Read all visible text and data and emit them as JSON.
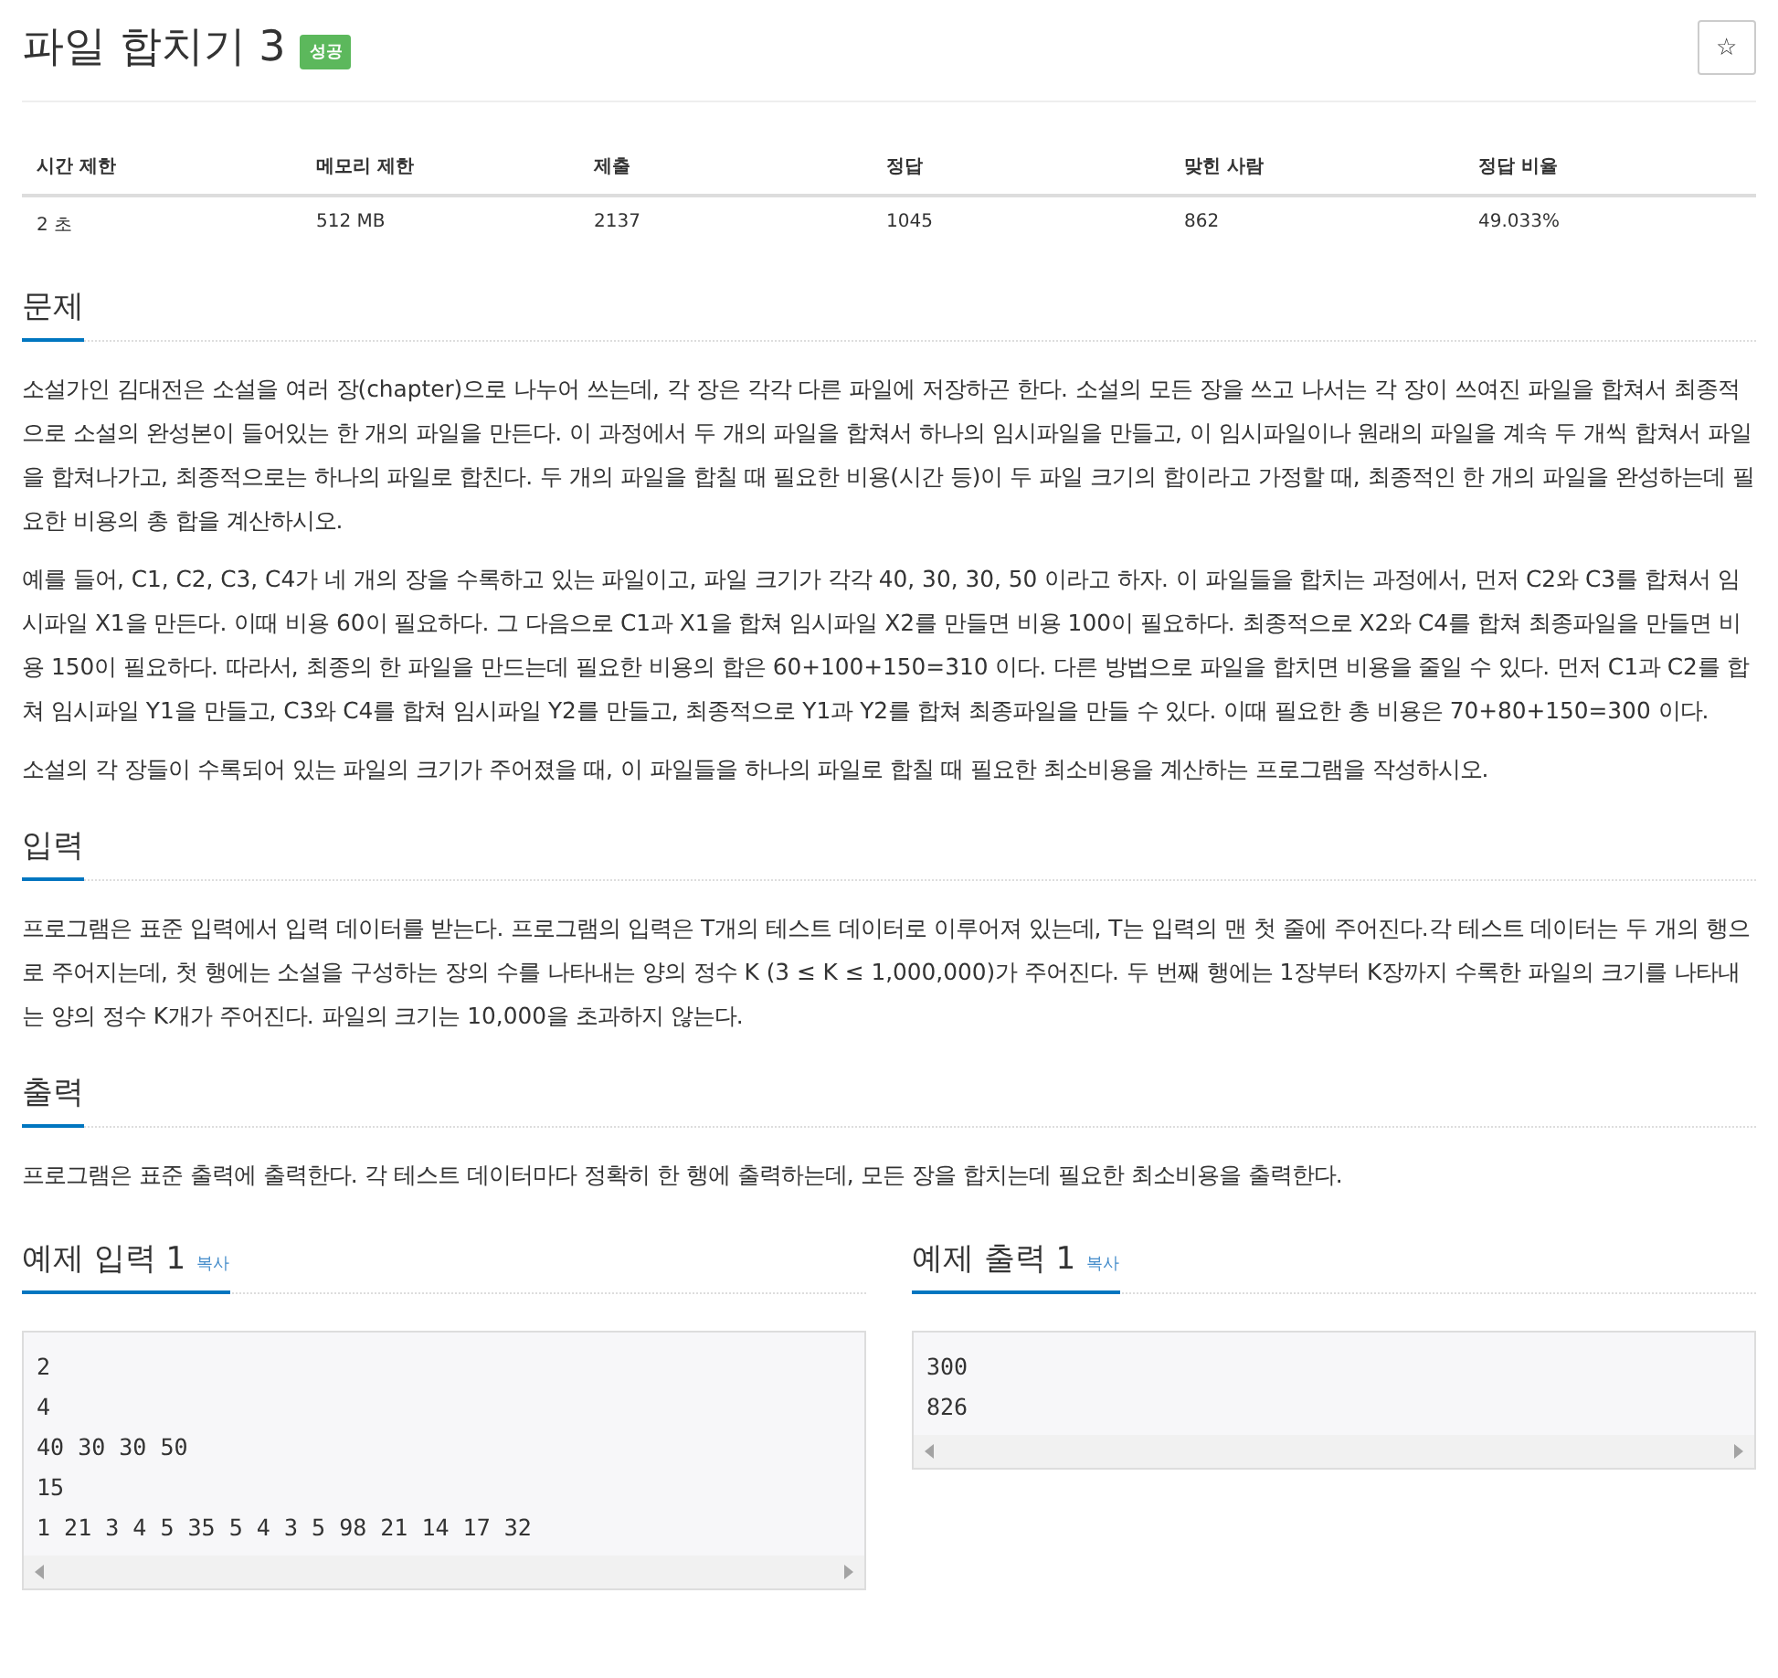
{
  "title": "파일 합치기 3",
  "badge": "성공",
  "star": "☆",
  "info_table": {
    "columns": [
      "시간 제한",
      "메모리 제한",
      "제출",
      "정답",
      "맞힌 사람",
      "정답 비율"
    ],
    "row": [
      "2 초",
      "512 MB",
      "2137",
      "1045",
      "862",
      "49.033%"
    ]
  },
  "sections": [
    {
      "heading": "문제",
      "paragraphs": [
        "소설가인 김대전은 소설을 여러 장(chapter)으로 나누어 쓰는데, 각 장은 각각 다른 파일에 저장하곤 한다. 소설의 모든 장을 쓰고 나서는 각 장이 쓰여진 파일을 합쳐서 최종적으로 소설의 완성본이 들어있는 한 개의 파일을 만든다. 이 과정에서 두 개의 파일을 합쳐서 하나의 임시파일을 만들고, 이 임시파일이나 원래의 파일을 계속 두 개씩 합쳐서 파일을 합쳐나가고, 최종적으로는 하나의 파일로 합친다. 두 개의 파일을 합칠 때 필요한 비용(시간 등)이 두 파일 크기의 합이라고 가정할 때, 최종적인 한 개의 파일을 완성하는데 필요한 비용의 총 합을 계산하시오.",
        "예를 들어, C1, C2, C3, C4가 네 개의 장을 수록하고 있는 파일이고, 파일 크기가 각각 40, 30, 30, 50 이라고 하자. 이 파일들을 합치는 과정에서, 먼저 C2와 C3를 합쳐서 임시파일 X1을 만든다. 이때 비용 60이 필요하다. 그 다음으로 C1과 X1을 합쳐 임시파일 X2를 만들면 비용 100이 필요하다. 최종적으로 X2와 C4를 합쳐 최종파일을 만들면 비용 150이 필요하다. 따라서, 최종의 한 파일을 만드는데 필요한 비용의 합은 60+100+150=310 이다. 다른 방법으로 파일을 합치면 비용을 줄일 수 있다. 먼저 C1과 C2를 합쳐 임시파일 Y1을 만들고, C3와 C4를 합쳐 임시파일 Y2를 만들고, 최종적으로 Y1과 Y2를 합쳐 최종파일을 만들 수 있다. 이때 필요한 총 비용은 70+80+150=300 이다.",
        "소설의 각 장들이 수록되어 있는 파일의 크기가 주어졌을 때, 이 파일들을 하나의 파일로 합칠 때 필요한 최소비용을 계산하는 프로그램을 작성하시오."
      ]
    },
    {
      "heading": "입력",
      "paragraphs": [
        "프로그램은 표준 입력에서 입력 데이터를 받는다. 프로그램의 입력은 T개의 테스트 데이터로 이루어져 있는데, T는 입력의 맨 첫 줄에 주어진다.각 테스트 데이터는 두 개의 행으로 주어지는데, 첫 행에는 소설을 구성하는 장의 수를 나타내는 양의 정수 K (3 ≤ K ≤ 1,000,000)가 주어진다. 두 번째 행에는 1장부터 K장까지 수록한 파일의 크기를 나타내는 양의 정수 K개가 주어진다. 파일의 크기는 10,000을 초과하지 않는다."
      ]
    },
    {
      "heading": "출력",
      "paragraphs": [
        "프로그램은 표준 출력에 출력한다. 각 테스트 데이터마다 정확히 한 행에 출력하는데, 모든 장을 합치는데 필요한 최소비용을 출력한다."
      ]
    }
  ],
  "samples": [
    {
      "heading": "예제 입력 1",
      "copy": "복사",
      "lines": [
        "2",
        "4",
        "40 30 30 50",
        "15",
        "1 21 3 4 5 35 5 4 3 5 98 21 14 17 32"
      ]
    },
    {
      "heading": "예제 출력 1",
      "copy": "복사",
      "lines": [
        "300",
        "826"
      ]
    }
  ]
}
